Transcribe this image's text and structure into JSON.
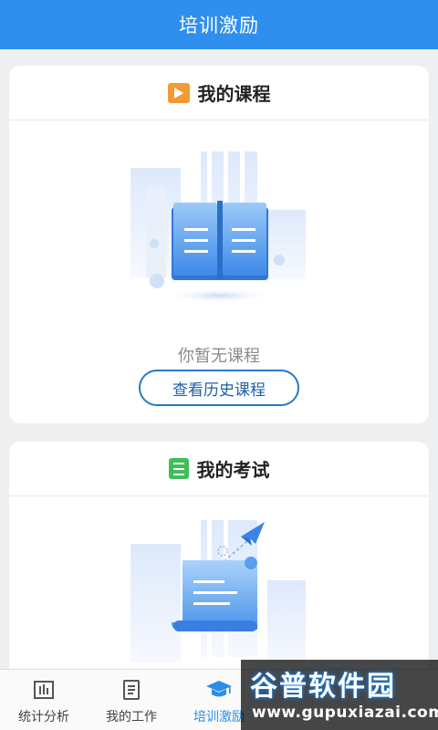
{
  "header": {
    "title": "培训激励"
  },
  "courses": {
    "title": "我的课程",
    "title_icon": "play-icon",
    "empty_text": "你暂无课程",
    "history_button": "查看历史课程",
    "illustration": "open-book-illustration"
  },
  "exams": {
    "title": "我的考试",
    "title_icon": "list-icon",
    "illustration": "exam-paper-plane-illustration"
  },
  "tabs": [
    {
      "label": "统计分析",
      "icon": "bar-chart-icon",
      "active": false
    },
    {
      "label": "我的工作",
      "icon": "document-icon",
      "active": false
    },
    {
      "label": "培训激励",
      "icon": "graduation-cap-icon",
      "active": true
    },
    {
      "label": "",
      "icon": "",
      "active": false
    },
    {
      "label": "",
      "icon": "",
      "active": false
    }
  ],
  "watermark": {
    "title": "谷普软件园",
    "url": "www.gupuxiazai.com"
  },
  "colors": {
    "primary": "#2f8fef",
    "course_icon": "#f39b32",
    "exam_icon": "#3fbd5c",
    "button_border": "#2878c8",
    "active_tab": "#2a8ee8"
  }
}
